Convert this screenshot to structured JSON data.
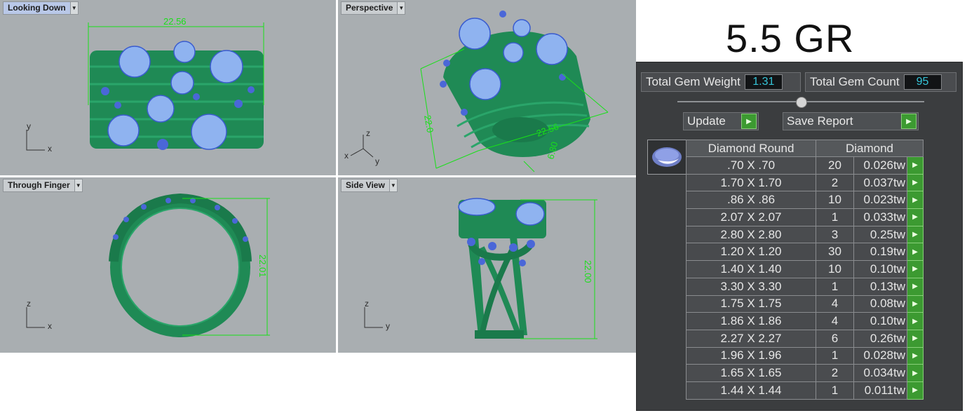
{
  "weight_title": "5.5 GR",
  "viewports": {
    "top": {
      "label": "Looking Down",
      "dimension": "22.56",
      "axis_v": "y",
      "axis_h": "x"
    },
    "perspective": {
      "label": "Perspective",
      "dim_a": "22.56",
      "dim_b": "22.0",
      "dim_c": "6.80",
      "axis_v": "z",
      "axis_x": "x",
      "axis_y": "y"
    },
    "finger": {
      "label": "Through Finger",
      "dimension": "22.01",
      "axis_v": "z",
      "axis_h": "x"
    },
    "side": {
      "label": "Side View",
      "dimension": "22.00",
      "axis_v": "z",
      "axis_h": "y"
    }
  },
  "panel": {
    "total_weight_label": "Total Gem Weight",
    "total_weight_value": "1.31",
    "total_count_label": "Total Gem Count",
    "total_count_value": "95",
    "update_label": "Update",
    "save_report_label": "Save Report",
    "table": {
      "header_shape": "Diamond Round",
      "header_material": "Diamond",
      "rows": [
        {
          "size": ".70 X .70",
          "count": "20",
          "weight": "0.026tw"
        },
        {
          "size": "1.70 X 1.70",
          "count": "2",
          "weight": "0.037tw"
        },
        {
          "size": ".86 X .86",
          "count": "10",
          "weight": "0.023tw"
        },
        {
          "size": "2.07 X 2.07",
          "count": "1",
          "weight": "0.033tw"
        },
        {
          "size": "2.80 X 2.80",
          "count": "3",
          "weight": "0.25tw"
        },
        {
          "size": "1.20 X 1.20",
          "count": "30",
          "weight": "0.19tw"
        },
        {
          "size": "1.40 X 1.40",
          "count": "10",
          "weight": "0.10tw"
        },
        {
          "size": "3.30 X 3.30",
          "count": "1",
          "weight": "0.13tw"
        },
        {
          "size": "1.75 X 1.75",
          "count": "4",
          "weight": "0.08tw"
        },
        {
          "size": "1.86 X 1.86",
          "count": "4",
          "weight": "0.10tw"
        },
        {
          "size": "2.27 X 2.27",
          "count": "6",
          "weight": "0.26tw"
        },
        {
          "size": "1.96 X 1.96",
          "count": "1",
          "weight": "0.028tw"
        },
        {
          "size": "1.65 X 1.65",
          "count": "2",
          "weight": "0.034tw"
        },
        {
          "size": "1.44 X 1.44",
          "count": "1",
          "weight": "0.011tw"
        }
      ]
    }
  },
  "colors": {
    "viewport_bg": "#a9aeb1",
    "ring_green": "#1f8a55",
    "gem_blue": "#8fb3f0",
    "dimension_green": "#19e019",
    "value_cyan": "#35c4d8",
    "button_green": "#3c9a31"
  }
}
